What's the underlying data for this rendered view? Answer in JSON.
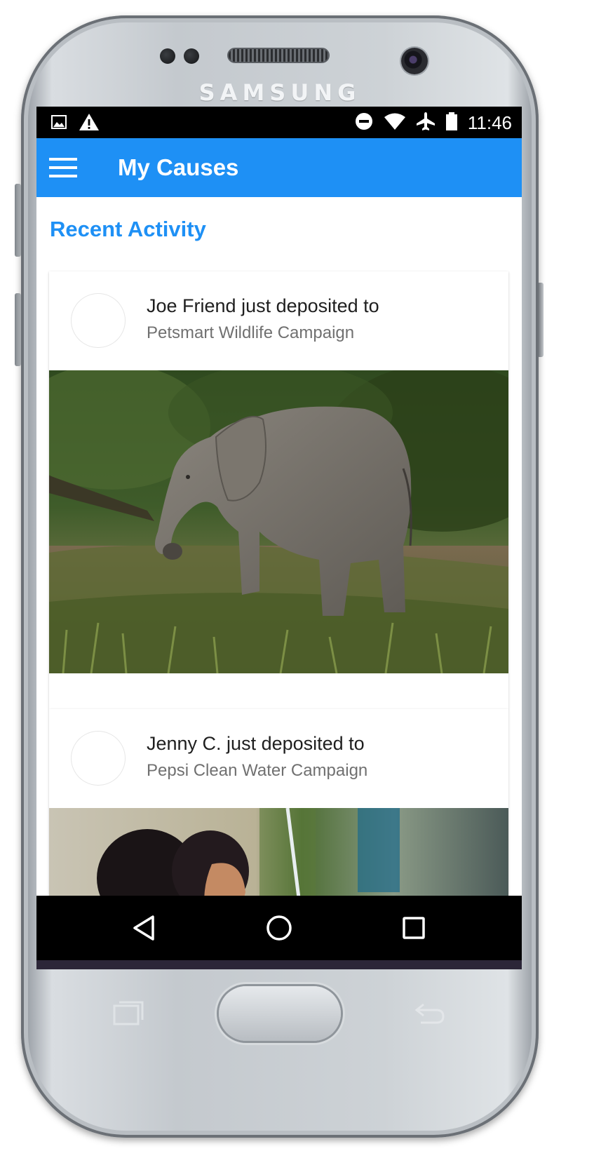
{
  "device": {
    "brand": "SAMSUNG"
  },
  "status_bar": {
    "time": "11:46",
    "left_icons": [
      "image-icon",
      "warning-icon"
    ],
    "right_icons": [
      "do-not-disturb-icon",
      "wifi-icon",
      "airplane-icon",
      "battery-icon"
    ]
  },
  "app_bar": {
    "title": "My Causes",
    "menu_icon": "hamburger-menu-icon"
  },
  "main": {
    "section_title": "Recent Activity",
    "activity": [
      {
        "actor_text": "Joe Friend just deposited to",
        "campaign": "Petsmart Wildlife Campaign",
        "image": "elephant-photo"
      },
      {
        "actor_text": "Jenny C. just deposited to",
        "campaign": "Pepsi Clean Water Campaign",
        "image": "children-water-photo"
      }
    ]
  },
  "nav_bar": {
    "buttons": [
      "back-icon",
      "home-icon",
      "recent-apps-icon"
    ]
  },
  "colors": {
    "primary": "#1e90f5",
    "status_bar": "#000000",
    "text_primary": "#1f1f1f",
    "text_secondary": "#707070"
  }
}
